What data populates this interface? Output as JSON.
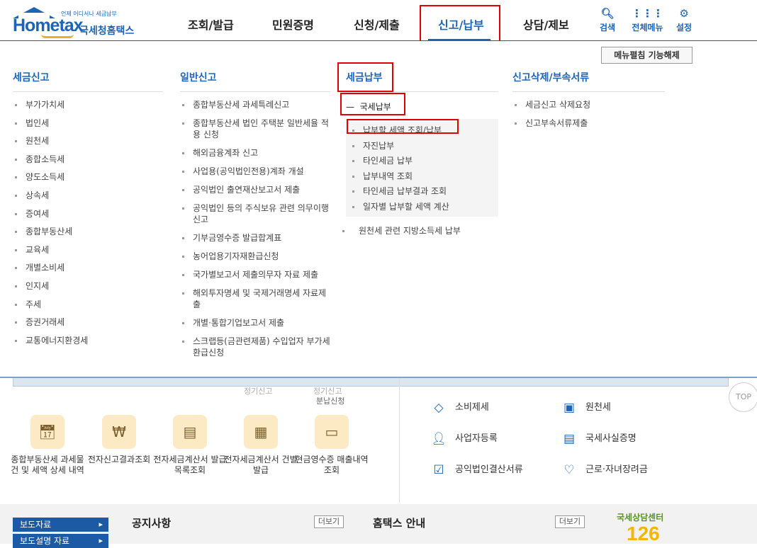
{
  "logo": {
    "small": "언제 어디서나 세금납부",
    "word": "Hometax",
    "name": "국세청홈택스"
  },
  "nav": {
    "items": [
      "조회/발급",
      "민원증명",
      "신청/제출",
      "신고/납부",
      "상담/제보"
    ],
    "active": "신고/납부"
  },
  "tools": {
    "search": "검색",
    "all_menu": "전체메뉴",
    "settings": "설정"
  },
  "mega": {
    "edit_button": "메뉴펼침 기능해제",
    "columns": [
      {
        "title": "세금신고",
        "items": [
          "부가가치세",
          "법인세",
          "원천세",
          "종합소득세",
          "양도소득세",
          "상속세",
          "증여세",
          "종합부동산세",
          "교육세",
          "개별소비세",
          "인지세",
          "주세",
          "증권거래세",
          "교통에너지환경세"
        ]
      },
      {
        "title": "일반신고",
        "items": [
          "종합부동산세 과세특례신고",
          "종합부동산세 법인 주택분 일반세율 적용 신청",
          "해외금융계좌 신고",
          "사업용(공익법인전용)계좌 개설",
          "공익법인 출연재산보고서 제출",
          "공익법인 등의 주식보유 관련 의무이행 신고",
          "기부금영수증 발급합계표",
          "농어업용기자재환급신청",
          "국가별보고서 제출의무자 자료 제출",
          "해외투자명세 및 국제거래명세 자료제출",
          "개별·통합기업보고서 제출",
          "스크랩등(금관련제품) 수입업자 부가세 환급신청"
        ]
      },
      {
        "title": "세금납부",
        "group": "국세납부",
        "sub_items": [
          "납부할 세액 조회/납부",
          "자진납부",
          "타인세금 납부",
          "납부내역 조회",
          "타인세금 납부결과 조회",
          "일자별 납부할 세액 계산"
        ],
        "items": [
          "원천세 관련 지방소득세 납부"
        ]
      },
      {
        "title": "신고삭제/부속서류",
        "items": [
          "세금신고 삭제요청",
          "신고부속서류제출"
        ]
      }
    ]
  },
  "below": {
    "faded1": "정기신고",
    "faded2": "정기신고",
    "faded3": "분납신청",
    "top": "TOP",
    "tiles": [
      "종합부동산세 과세물건 및 세액 상세 내역",
      "전자신고결과조회",
      "전자세금계산서 발급목록조회",
      "전자세금계산서 건별발급",
      "현금영수증 매출내역 조회"
    ],
    "services": [
      "소비제세",
      "원천세",
      "사업자등록",
      "국세사실증명",
      "공익법인결산서류",
      "근로·자녀장려금"
    ],
    "btn1": "보도자료",
    "btn2": "보도설명 자료",
    "notice": "공지사항",
    "guide": "홈택스 안내",
    "more": "더보기",
    "callcenter_title": "국세상담센터",
    "callcenter_num": "126"
  }
}
